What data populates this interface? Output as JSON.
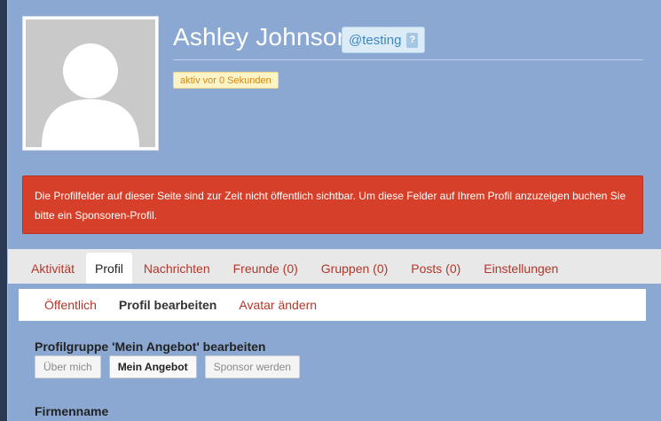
{
  "profile": {
    "display_name": "Ashley Johnson",
    "handle": "@testing",
    "handle_help": "?",
    "activity": "aktiv vor 0 Sekunden"
  },
  "notice": {
    "text": "Die Profilfelder auf dieser Seite sind zur Zeit nicht öffentlich sichtbar. Um diese Felder auf Ihrem Profil anzuzeigen buchen Sie bitte ein Sponsoren-Profil."
  },
  "tabs": [
    {
      "label": "Aktivität",
      "active": false
    },
    {
      "label": "Profil",
      "active": true
    },
    {
      "label": "Nachrichten",
      "active": false
    },
    {
      "label": "Freunde (0)",
      "active": false
    },
    {
      "label": "Gruppen (0)",
      "active": false
    },
    {
      "label": "Posts (0)",
      "active": false
    },
    {
      "label": "Einstellungen",
      "active": false
    }
  ],
  "subnav": [
    {
      "label": "Öffentlich",
      "active": false
    },
    {
      "label": "Profil bearbeiten",
      "active": true
    },
    {
      "label": "Avatar ändern",
      "active": false
    }
  ],
  "form": {
    "group_title": "Profilgruppe 'Mein Angebot' bearbeiten",
    "group_buttons": [
      {
        "label": "Über mich",
        "active": false
      },
      {
        "label": "Mein Angebot",
        "active": true
      },
      {
        "label": "Sponsor werden",
        "active": false
      }
    ],
    "first_field_label": "Firmenname"
  },
  "colors": {
    "page_background": "#8aa8d2",
    "notice_background": "#d6402b",
    "link": "#b2372a",
    "activity_badge": "#fcf3c6"
  }
}
